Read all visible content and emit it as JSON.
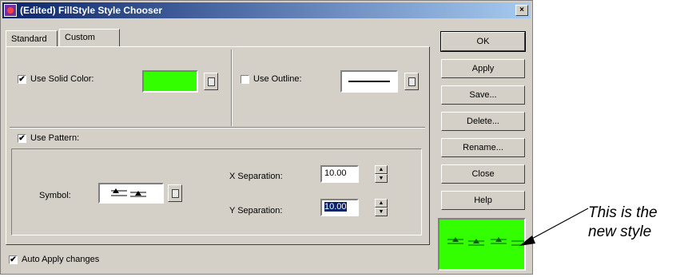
{
  "window": {
    "title": "(Edited) FillStyle Style Chooser",
    "close_glyph": "×"
  },
  "tabs": [
    {
      "label": "Standard"
    },
    {
      "label": "Custom"
    }
  ],
  "custom": {
    "use_solid_color": {
      "label": "Use Solid Color:",
      "checked": true,
      "color": "#33ff00"
    },
    "use_outline": {
      "label": "Use Outline:",
      "checked": false
    },
    "use_pattern": {
      "label": "Use Pattern:",
      "checked": true
    },
    "symbol_label": "Symbol:",
    "x_separation": {
      "label": "X Separation:",
      "value": "10.00"
    },
    "y_separation": {
      "label": "Y Separation:",
      "value": "10.00"
    },
    "auto_apply": {
      "label": "Auto Apply changes",
      "checked": true
    }
  },
  "buttons": {
    "ok": "OK",
    "apply": "Apply",
    "save": "Save...",
    "delete": "Delete...",
    "rename": "Rename...",
    "close": "Close",
    "help": "Help"
  },
  "preview": {
    "color": "#33ff00"
  },
  "annotation": {
    "line1": "This is the",
    "line2": "new style"
  },
  "check_glyph": "✔",
  "spin_up": "▲",
  "spin_down": "▼"
}
